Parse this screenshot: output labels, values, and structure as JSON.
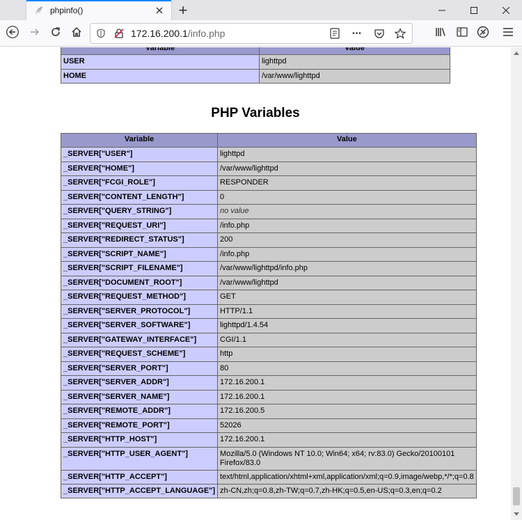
{
  "browser": {
    "tab_title": "phpinfo()",
    "url_host": "172.16.200.1",
    "url_path": "/info.php",
    "new_tab_symbol": "+",
    "more_symbol": "•••"
  },
  "env_table": {
    "header": [
      "Variable",
      "Value"
    ],
    "rows": [
      {
        "name": "USER",
        "value": "lighttpd"
      },
      {
        "name": "HOME",
        "value": "/var/www/lighttpd"
      }
    ]
  },
  "php_variables": {
    "title": "PHP Variables",
    "header": [
      "Variable",
      "Value"
    ],
    "rows": [
      {
        "name": "_SERVER[\"USER\"]",
        "value": "lighttpd"
      },
      {
        "name": "_SERVER[\"HOME\"]",
        "value": "/var/www/lighttpd"
      },
      {
        "name": "_SERVER[\"FCGI_ROLE\"]",
        "value": "RESPONDER"
      },
      {
        "name": "_SERVER[\"CONTENT_LENGTH\"]",
        "value": "0"
      },
      {
        "name": "_SERVER[\"QUERY_STRING\"]",
        "value": "no value"
      },
      {
        "name": "_SERVER[\"REQUEST_URI\"]",
        "value": "/info.php"
      },
      {
        "name": "_SERVER[\"REDIRECT_STATUS\"]",
        "value": "200"
      },
      {
        "name": "_SERVER[\"SCRIPT_NAME\"]",
        "value": "/info.php"
      },
      {
        "name": "_SERVER[\"SCRIPT_FILENAME\"]",
        "value": "/var/www/lighttpd/info.php"
      },
      {
        "name": "_SERVER[\"DOCUMENT_ROOT\"]",
        "value": "/var/www/lighttpd"
      },
      {
        "name": "_SERVER[\"REQUEST_METHOD\"]",
        "value": "GET"
      },
      {
        "name": "_SERVER[\"SERVER_PROTOCOL\"]",
        "value": "HTTP/1.1"
      },
      {
        "name": "_SERVER[\"SERVER_SOFTWARE\"]",
        "value": "lighttpd/1.4.54"
      },
      {
        "name": "_SERVER[\"GATEWAY_INTERFACE\"]",
        "value": "CGI/1.1"
      },
      {
        "name": "_SERVER[\"REQUEST_SCHEME\"]",
        "value": "http"
      },
      {
        "name": "_SERVER[\"SERVER_PORT\"]",
        "value": "80"
      },
      {
        "name": "_SERVER[\"SERVER_ADDR\"]",
        "value": "172.16.200.1"
      },
      {
        "name": "_SERVER[\"SERVER_NAME\"]",
        "value": "172.16.200.1"
      },
      {
        "name": "_SERVER[\"REMOTE_ADDR\"]",
        "value": "172.16.200.5"
      },
      {
        "name": "_SERVER[\"REMOTE_PORT\"]",
        "value": "52026"
      },
      {
        "name": "_SERVER[\"HTTP_HOST\"]",
        "value": "172.16.200.1"
      },
      {
        "name": "_SERVER[\"HTTP_USER_AGENT\"]",
        "value": "Mozilla/5.0 (Windows NT 10.0; Win64; x64; rv:83.0) Gecko/20100101 Firefox/83.0"
      },
      {
        "name": "_SERVER[\"HTTP_ACCEPT\"]",
        "value": "text/html,application/xhtml+xml,application/xml;q=0.9,image/webp,*/*;q=0.8"
      },
      {
        "name": "_SERVER[\"HTTP_ACCEPT_LANGUAGE\"]",
        "value": "zh-CN,zh;q=0.8,zh-TW;q=0.7,zh-HK;q=0.5,en-US;q=0.3,en;q=0.2"
      }
    ]
  },
  "colors": {
    "header_bg": "#9999cc",
    "name_cell_bg": "#ccccff",
    "value_cell_bg": "#cccccc",
    "tab_accent": "#0a84ff"
  }
}
